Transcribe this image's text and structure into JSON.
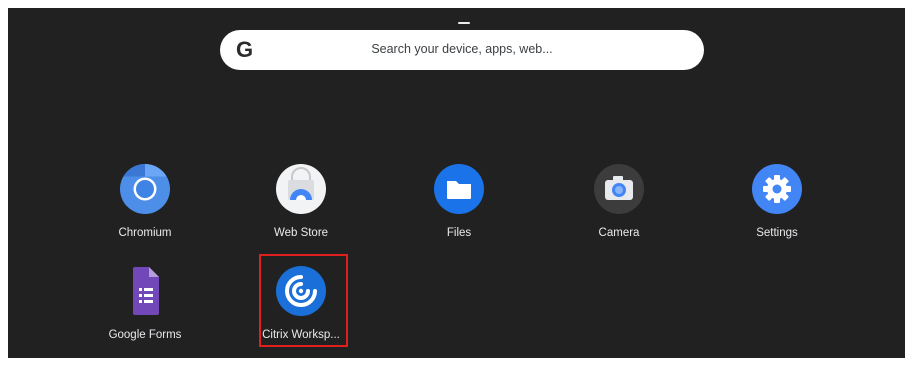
{
  "search": {
    "logo_text": "G",
    "placeholder": "Search your device, apps, web..."
  },
  "apps": [
    {
      "label": "Chromium",
      "icon": "chromium-icon"
    },
    {
      "label": "Web Store",
      "icon": "web-store-icon"
    },
    {
      "label": "Files",
      "icon": "files-icon"
    },
    {
      "label": "Camera",
      "icon": "camera-icon"
    },
    {
      "label": "Settings",
      "icon": "settings-icon"
    },
    {
      "label": "Google Forms",
      "icon": "google-forms-icon"
    },
    {
      "label": "Citrix Worksp...",
      "icon": "citrix-workspace-icon"
    }
  ],
  "colors": {
    "background": "#212121",
    "highlight": "#e01f1f",
    "label_text": "#e8eaed"
  }
}
